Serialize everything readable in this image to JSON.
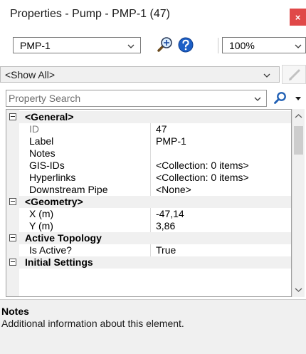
{
  "window": {
    "title": "Properties - Pump - PMP-1 (47)",
    "close_glyph": "×"
  },
  "toolbar": {
    "element_value": "PMP-1",
    "zoom_value": "100%",
    "icons": [
      "zoom-in-icon",
      "help-icon"
    ]
  },
  "filter": {
    "value": "<Show All>"
  },
  "search": {
    "placeholder": "Property Search"
  },
  "grid": {
    "categories": [
      {
        "label": "<General>"
      },
      {
        "label": "<Geometry>"
      },
      {
        "label": "Active Topology"
      },
      {
        "label": "Initial Settings"
      }
    ],
    "general": [
      {
        "name": "ID",
        "value": "47"
      },
      {
        "name": "Label",
        "value": "PMP-1"
      },
      {
        "name": "Notes",
        "value": ""
      },
      {
        "name": "GIS-IDs",
        "value": "<Collection: 0 items>"
      },
      {
        "name": "Hyperlinks",
        "value": "<Collection: 0 items>"
      },
      {
        "name": "Downstream Pipe",
        "value": "<None>"
      }
    ],
    "geometry": [
      {
        "name": "X (m)",
        "value": "-47,14"
      },
      {
        "name": "Y (m)",
        "value": "3,86"
      }
    ],
    "topology": [
      {
        "name": "Is Active?",
        "value": "True"
      }
    ]
  },
  "description": {
    "title": "Notes",
    "text": "Additional information about this element."
  },
  "colors": {
    "close_bg": "#e04848",
    "category_bg": "#f0f0f0",
    "search_icon": "#1f5fb4"
  }
}
